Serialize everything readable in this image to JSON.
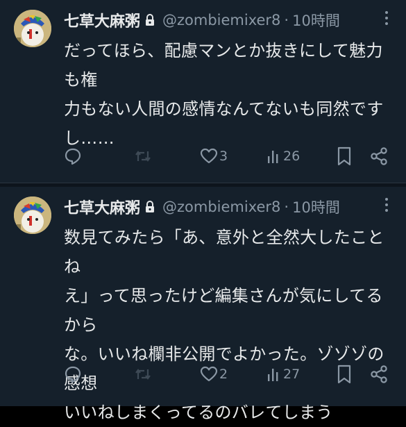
{
  "tweets": [
    {
      "name": "七草大麻粥",
      "handle": "@zombiemixer8",
      "separator": "·",
      "time": "10時間",
      "text": "だってほら、配慮マンとか抜きにして魅力も権\n力もない人間の感情なんてないも同然です\nし……",
      "likes": "3",
      "views": "26"
    },
    {
      "name": "七草大麻粥",
      "handle": "@zombiemixer8",
      "separator": "·",
      "time": "10時間",
      "text": "数見てみたら「あ、意外と全然大したことね\nえ」って思ったけど編集さんが気にしてるから\nな。いいね欄非公開でよかった。ゾゾゾの感想\nいいねしまくってるのバレてしまう",
      "likes": "2",
      "views": "27"
    }
  ],
  "icons": {
    "lock": "lock-icon",
    "more": "more-icon",
    "reply": "reply-icon",
    "retweet": "retweet-icon",
    "like": "heart-icon",
    "views": "views-icon",
    "bookmark": "bookmark-icon",
    "share": "share-icon"
  },
  "colors": {
    "background": "#15202b",
    "text": "#e7e9ea",
    "muted": "#8b98a5",
    "retweet_disabled": "#3e4a56"
  }
}
